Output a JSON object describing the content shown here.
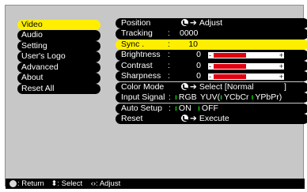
{
  "menu": {
    "items": [
      {
        "label": "Video"
      },
      {
        "label": "Audio"
      },
      {
        "label": "Setting"
      },
      {
        "label": "User's Logo"
      },
      {
        "label": "Advanced"
      },
      {
        "label": "About"
      },
      {
        "label": "Reset All"
      }
    ]
  },
  "panel": {
    "position": {
      "label": "Position",
      "action": "Adjust"
    },
    "tracking": {
      "label": "Tracking",
      "colon": ":",
      "value": "0000"
    },
    "sync": {
      "label": "Sync .",
      "colon": ":",
      "value": "10"
    },
    "brightness": {
      "label": "Brightness",
      "colon": ":",
      "value": "0",
      "level": 0.5
    },
    "contrast": {
      "label": "Contrast",
      "colon": ":",
      "value": "0",
      "level": 0.5
    },
    "sharpness": {
      "label": "Sharpness",
      "colon": ":",
      "value": "0",
      "level": 0.5
    },
    "color_mode": {
      "label": "Color Mode",
      "action": "Select",
      "value": "[Normal",
      "close": "]"
    },
    "input_signal": {
      "label": "Input Signal",
      "colon": ":",
      "opt1": "RGB",
      "opt2_prefix": "YUV(",
      "opt2a": "YCbCr",
      "opt2b": "YPbPr)"
    },
    "auto_setup": {
      "label": "Auto Setup",
      "colon": ":",
      "on": "ON",
      "off": "OFF"
    },
    "reset": {
      "label": "Reset",
      "action": "Execute"
    }
  },
  "footer": {
    "return_label": ": Return",
    "select_label": ": Select",
    "adjust_label": ": Adjust"
  },
  "colors": {
    "selected_bg": "#ffee00",
    "slider_fill": "#e00010",
    "radio": "#00d000"
  }
}
